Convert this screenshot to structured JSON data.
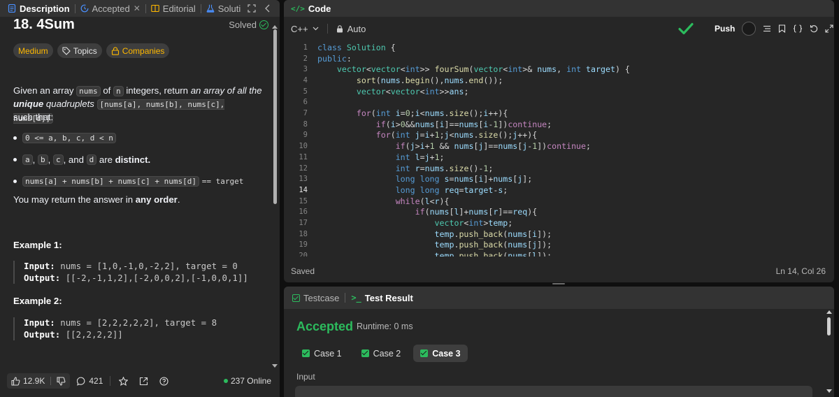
{
  "left_tabs": [
    {
      "label": "Description",
      "icon": "document-icon",
      "active": true
    },
    {
      "label": "Accepted",
      "icon": "history-icon",
      "active": false
    },
    {
      "label": "Editorial",
      "icon": "book-icon",
      "active": false
    },
    {
      "label": "Soluti",
      "icon": "flask-icon",
      "active": false
    }
  ],
  "problem": {
    "title": "18. 4Sum",
    "status": "Solved",
    "badges": {
      "difficulty": "Medium",
      "topics": "Topics",
      "companies": "Companies"
    },
    "desc_1": "Given an array",
    "desc_code_1": "nums",
    "desc_2": "of",
    "desc_code_2": "n",
    "desc_3": "integers, return",
    "desc_em": "an array of all the",
    "desc_em_b": "unique",
    "desc_em_2": "quadruplets",
    "desc_code_3": "[nums[a], nums[b], nums[c], nums[d]]",
    "desc_4": "such that:",
    "bullet_1": "0 <= a, b, c, d < n",
    "bullet_2_codes": [
      "a",
      "b",
      "c",
      "d"
    ],
    "bullet_2_sep1": ",",
    "bullet_2_and": "and",
    "bullet_2_are": "are",
    "bullet_2_distinct": "distinct.",
    "bullet_3_code": "nums[a] + nums[b] + nums[c] + nums[d]",
    "bullet_3_eq": "== target",
    "order_1": "You may return the answer in",
    "order_b": "any order",
    "order_end": ".",
    "example1_h": "Example 1:",
    "example1_input_label": "Input:",
    "example1_input": "nums = [1,0,-1,0,-2,2], target = 0",
    "example1_output_label": "Output:",
    "example1_output": "[[-2,-1,1,2],[-2,0,0,2],[-1,0,0,1]]",
    "example2_h": "Example 2:",
    "example2_input_label": "Input:",
    "example2_input": "nums = [2,2,2,2,2], target = 8",
    "example2_output_label": "Output:",
    "example2_output": "[[2,2,2,2]]"
  },
  "left_bottom": {
    "likes": "12.9K",
    "comments": "421",
    "online": "237 Online"
  },
  "code_panel": {
    "title": "Code",
    "language": "C++",
    "mode": "Auto",
    "saved": "Saved",
    "cursor": "Ln 14, Col 26",
    "push": "Push",
    "avatar_text": "",
    "current_line": 14
  },
  "code_lines": [
    {
      "n": "1",
      "html": "<span class='kw'>class</span> <span class='ty'>Solution</span> <span class='pl'>{</span>"
    },
    {
      "n": "2",
      "html": "<span class='kw'>public</span><span class='pl'>:</span>"
    },
    {
      "n": "3",
      "html": "    <span class='ty'>vector</span><span class='pl'>&lt;</span><span class='ty'>vector</span><span class='pl'>&lt;</span><span class='kw'>int</span><span class='pl'>&gt;&gt;</span> <span class='fn'>fourSum</span><span class='pl'>(</span><span class='ty'>vector</span><span class='pl'>&lt;</span><span class='kw'>int</span><span class='pl'>&gt;&amp;</span> <span class='vr'>nums</span><span class='pl'>,</span> <span class='kw'>int</span> <span class='vr'>target</span><span class='pl'>) {</span>"
    },
    {
      "n": "4",
      "html": "        <span class='fn'>sort</span><span class='pl'>(</span><span class='vr'>nums</span><span class='pl'>.</span><span class='fn'>begin</span><span class='pl'>(),</span><span class='vr'>nums</span><span class='pl'>.</span><span class='fn'>end</span><span class='pl'>());</span>"
    },
    {
      "n": "5",
      "html": "        <span class='ty'>vector</span><span class='pl'>&lt;</span><span class='ty'>vector</span><span class='pl'>&lt;</span><span class='kw'>int</span><span class='pl'>&gt;&gt;</span><span class='vr'>ans</span><span class='pl'>;</span>"
    },
    {
      "n": "6",
      "html": ""
    },
    {
      "n": "7",
      "html": "        <span class='kw2'>for</span><span class='pl'>(</span><span class='kw'>int</span> <span class='vr'>i</span><span class='pl'>=</span><span class='nm'>0</span><span class='pl'>;</span><span class='vr'>i</span><span class='pl'>&lt;</span><span class='vr'>nums</span><span class='pl'>.</span><span class='fn'>size</span><span class='pl'>();</span><span class='vr'>i</span><span class='pl'>++){</span>"
    },
    {
      "n": "8",
      "html": "            <span class='kw2'>if</span><span class='pl'>(</span><span class='vr'>i</span><span class='pl'>&gt;</span><span class='nm'>0</span><span class='pl'>&amp;&amp;</span><span class='vr'>nums</span><span class='pl'>[</span><span class='vr'>i</span><span class='pl'>]==</span><span class='vr'>nums</span><span class='pl'>[</span><span class='vr'>i</span><span class='pl'>-</span><span class='nm'>1</span><span class='pl'>])</span><span class='kw2'>continue</span><span class='pl'>;</span>"
    },
    {
      "n": "9",
      "html": "            <span class='kw2'>for</span><span class='pl'>(</span><span class='kw'>int</span> <span class='vr'>j</span><span class='pl'>=</span><span class='vr'>i</span><span class='pl'>+</span><span class='nm'>1</span><span class='pl'>;</span><span class='vr'>j</span><span class='pl'>&lt;</span><span class='vr'>nums</span><span class='pl'>.</span><span class='fn'>size</span><span class='pl'>();</span><span class='vr'>j</span><span class='pl'>++){</span>"
    },
    {
      "n": "10",
      "html": "                <span class='kw2'>if</span><span class='pl'>(</span><span class='vr'>j</span><span class='pl'>&gt;</span><span class='vr'>i</span><span class='pl'>+</span><span class='nm'>1</span> <span class='pl'>&amp;&amp;</span> <span class='vr'>nums</span><span class='pl'>[</span><span class='vr'>j</span><span class='pl'>]==</span><span class='vr'>nums</span><span class='pl'>[</span><span class='vr'>j</span><span class='pl'>-</span><span class='nm'>1</span><span class='pl'>])</span><span class='kw2'>continue</span><span class='pl'>;</span>"
    },
    {
      "n": "11",
      "html": "                <span class='kw'>int</span> <span class='vr'>l</span><span class='pl'>=</span><span class='vr'>j</span><span class='pl'>+</span><span class='nm'>1</span><span class='pl'>;</span>"
    },
    {
      "n": "12",
      "html": "                <span class='kw'>int</span> <span class='vr'>r</span><span class='pl'>=</span><span class='vr'>nums</span><span class='pl'>.</span><span class='fn'>size</span><span class='pl'>()-</span><span class='nm'>1</span><span class='pl'>;</span>"
    },
    {
      "n": "13",
      "html": "                <span class='kw'>long</span> <span class='kw'>long</span> <span class='vr'>s</span><span class='pl'>=</span><span class='vr'>nums</span><span class='pl'>[</span><span class='vr'>i</span><span class='pl'>]+</span><span class='vr'>nums</span><span class='pl'>[</span><span class='vr'>j</span><span class='pl'>];</span>"
    },
    {
      "n": "14",
      "html": "                <span class='kw'>long</span> <span class='kw'>long</span> <span class='vr'>req</span><span class='pl'>=</span><span class='vr'>target</span><span class='pl'>-</span><span class='vr'>s</span><span class='pl'>;</span>"
    },
    {
      "n": "15",
      "html": "                <span class='kw2'>while</span><span class='pl'>(</span><span class='vr'>l</span><span class='pl'>&lt;</span><span class='vr'>r</span><span class='pl'>){</span>"
    },
    {
      "n": "16",
      "html": "                    <span class='kw2'>if</span><span class='pl'>(</span><span class='vr'>nums</span><span class='pl'>[</span><span class='vr'>l</span><span class='pl'>]+</span><span class='vr'>nums</span><span class='pl'>[</span><span class='vr'>r</span><span class='pl'>]==</span><span class='vr'>req</span><span class='pl'>){</span>"
    },
    {
      "n": "17",
      "html": "                        <span class='ty'>vector</span><span class='pl'>&lt;</span><span class='kw'>int</span><span class='pl'>&gt;</span><span class='vr'>temp</span><span class='pl'>;</span>"
    },
    {
      "n": "18",
      "html": "                        <span class='vr'>temp</span><span class='pl'>.</span><span class='fn'>push_back</span><span class='pl'>(</span><span class='vr'>nums</span><span class='pl'>[</span><span class='vr'>i</span><span class='pl'>]);</span>"
    },
    {
      "n": "19",
      "html": "                        <span class='vr'>temp</span><span class='pl'>.</span><span class='fn'>push_back</span><span class='pl'>(</span><span class='vr'>nums</span><span class='pl'>[</span><span class='vr'>j</span><span class='pl'>]);</span>"
    },
    {
      "n": "20",
      "html": "                        <span class='vr'>temp</span><span class='pl'>.</span><span class='fn'>push_back</span><span class='pl'>(</span><span class='vr'>nums</span><span class='pl'>[</span><span class='vr'>l</span><span class='pl'>]);</span>"
    }
  ],
  "result_panel": {
    "tab_testcase": "Testcase",
    "tab_result": "Test Result",
    "verdict": "Accepted",
    "runtime": "Runtime: 0 ms",
    "cases": [
      "Case 1",
      "Case 2",
      "Case 3"
    ],
    "active_case": 2,
    "input_label": "Input"
  },
  "colors": {
    "accent_green": "#2cbb5d",
    "medium": "#ffb800",
    "bg": "#262626"
  }
}
